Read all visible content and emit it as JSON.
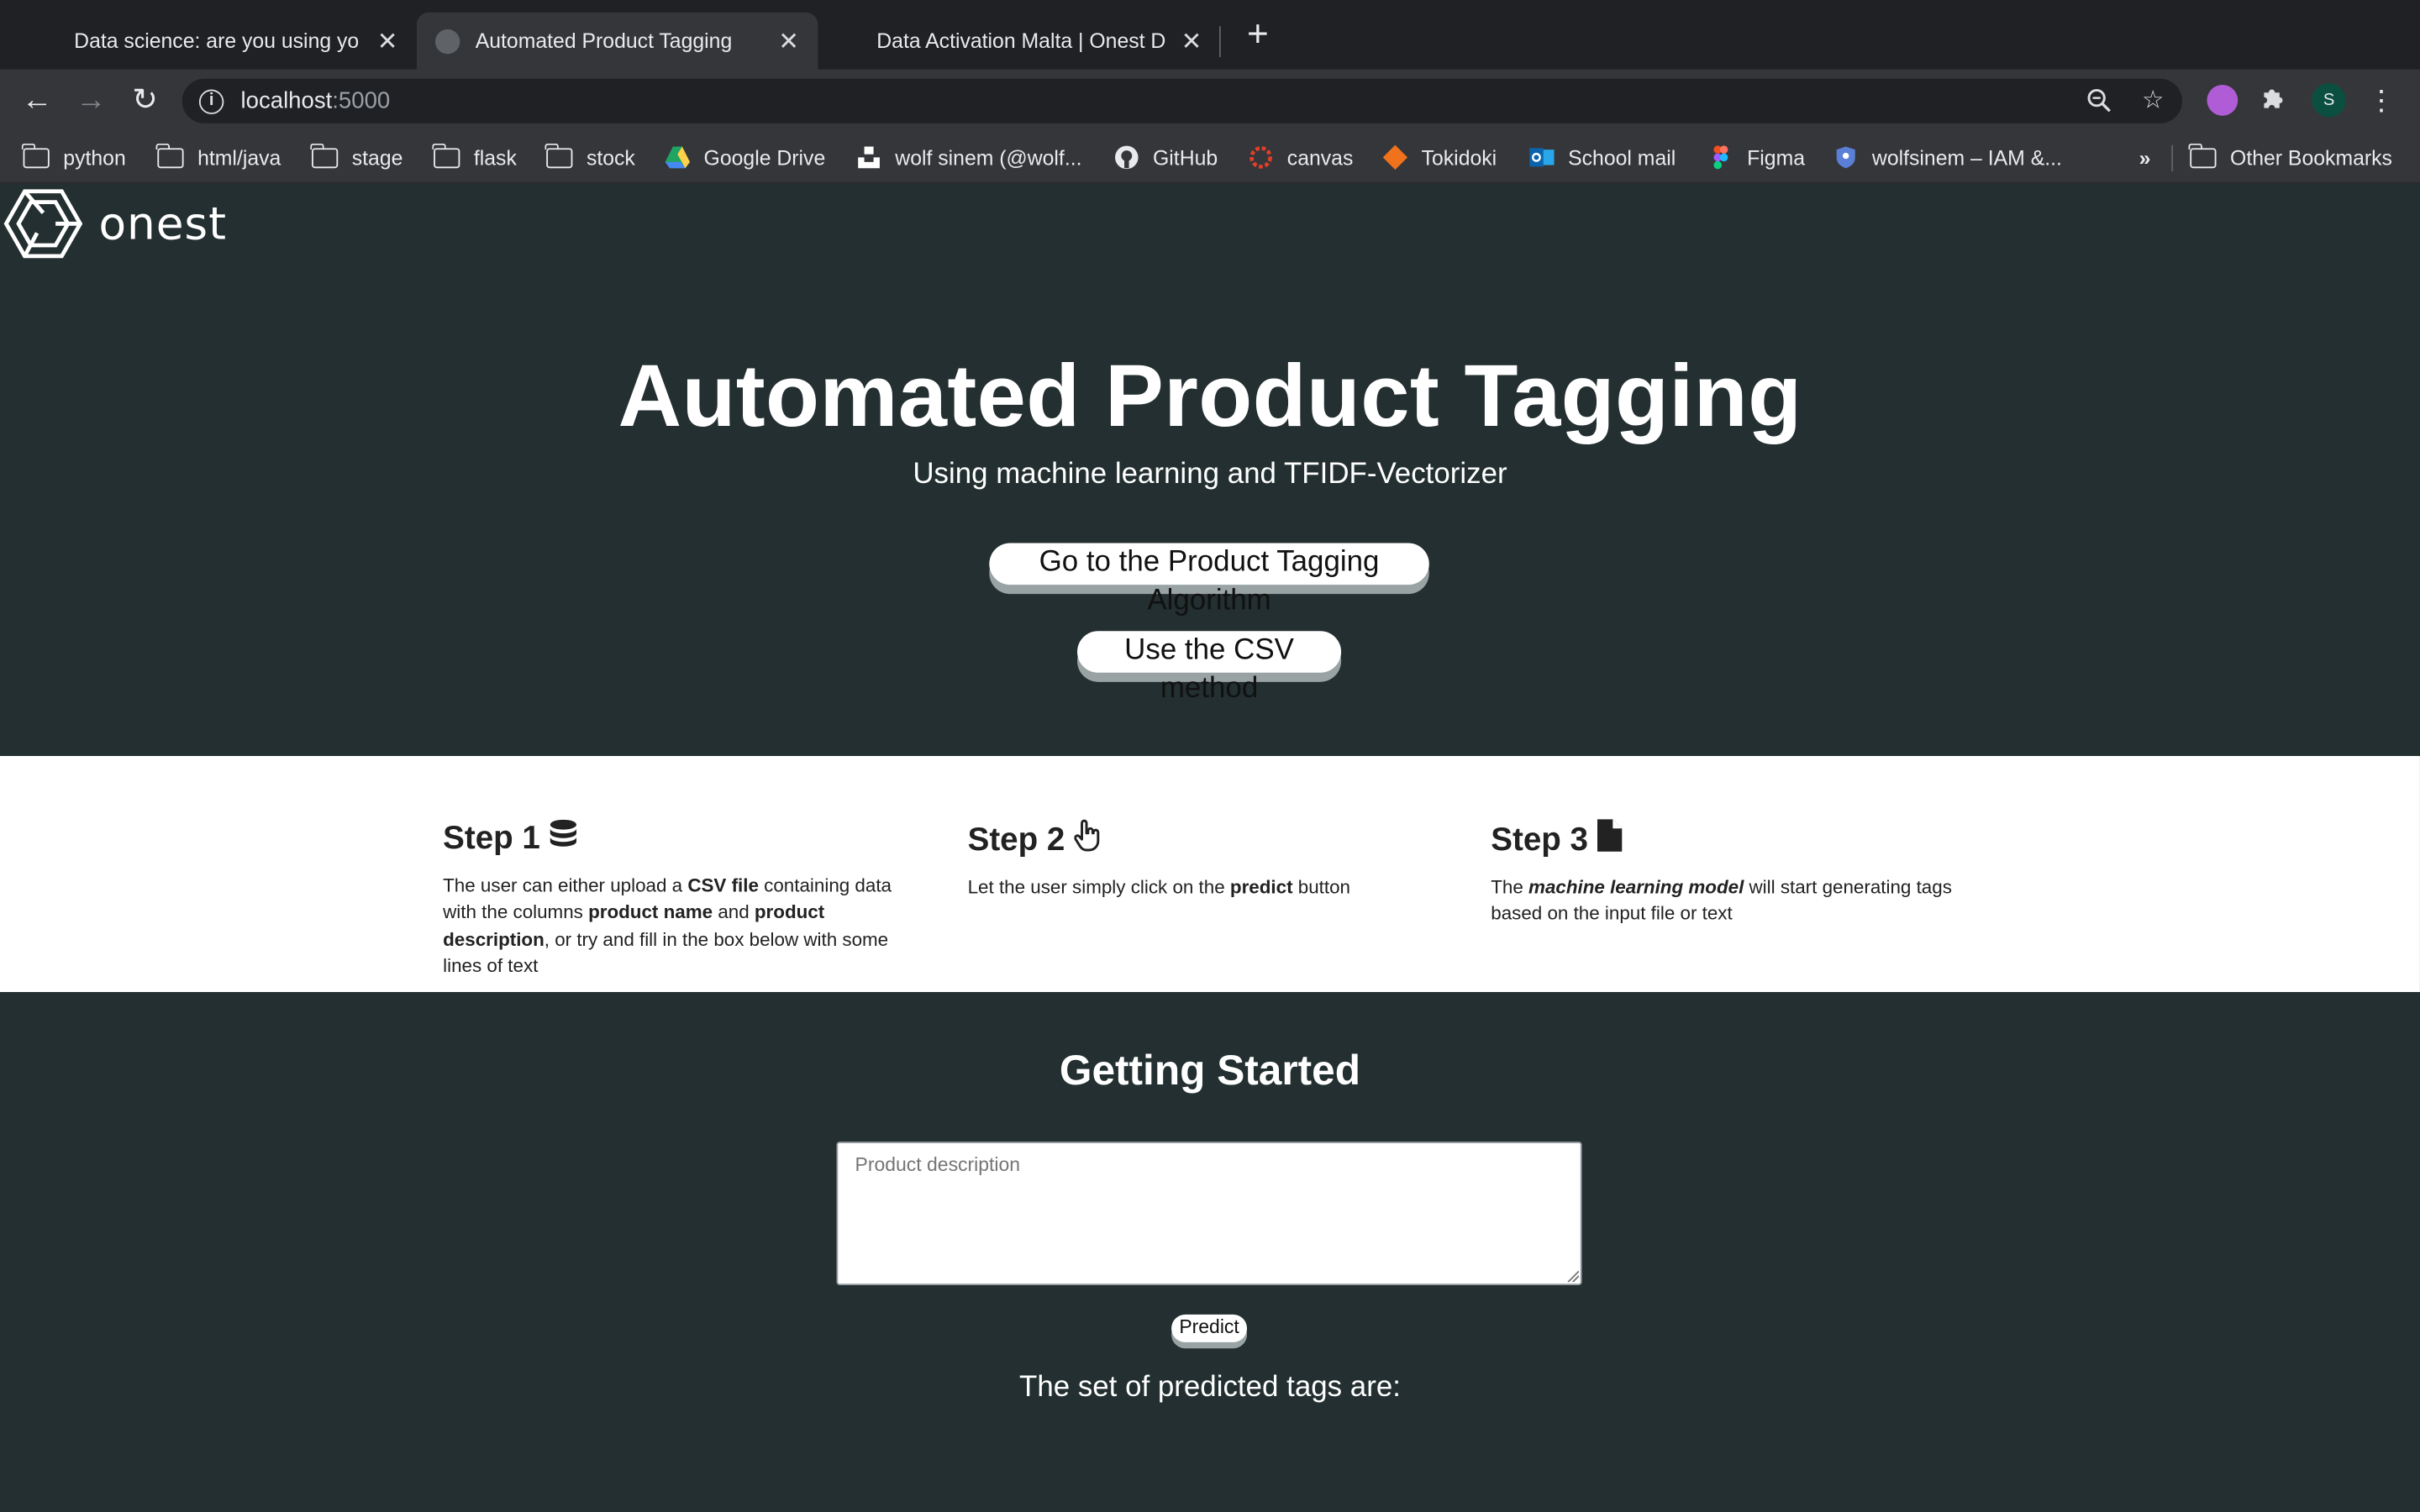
{
  "browser": {
    "tabs": [
      {
        "title": "Data science: are you using yo",
        "active": false
      },
      {
        "title": "Automated Product Tagging",
        "active": true
      },
      {
        "title": "Data Activation Malta | Onest D",
        "active": false
      }
    ],
    "new_tab_icon": "plus-icon",
    "url_host": "localhost",
    "url_port": ":5000",
    "bookmarks": [
      {
        "label": "python",
        "icon": "folder-icon"
      },
      {
        "label": "html/java",
        "icon": "folder-icon"
      },
      {
        "label": "stage",
        "icon": "folder-icon"
      },
      {
        "label": "flask",
        "icon": "folder-icon"
      },
      {
        "label": "stock",
        "icon": "folder-icon"
      },
      {
        "label": "Google Drive",
        "icon": "google-drive-icon"
      },
      {
        "label": "wolf sinem (@wolf...",
        "icon": "unsplash-icon"
      },
      {
        "label": "GitHub",
        "icon": "github-icon"
      },
      {
        "label": "canvas",
        "icon": "canvas-icon"
      },
      {
        "label": "Tokidoki",
        "icon": "tokidoki-icon"
      },
      {
        "label": "School mail",
        "icon": "outlook-icon"
      },
      {
        "label": "Figma",
        "icon": "figma-icon"
      },
      {
        "label": "wolfsinem – IAM &...",
        "icon": "shield-icon"
      }
    ],
    "overflow_label": "»",
    "other_bookmarks": "Other Bookmarks",
    "profile_initial": "S"
  },
  "brand": {
    "logo_text": "onest"
  },
  "hero": {
    "title": "Automated Product Tagging",
    "subtitle": "Using machine learning and TFIDF-Vectorizer",
    "button_algorithm": "Go to the Product Tagging Algorithm",
    "button_csv": "Use the CSV method"
  },
  "steps": [
    {
      "title": "Step 1",
      "icon": "database-icon",
      "parts": [
        {
          "t": "The user can either upload a ",
          "b": false
        },
        {
          "t": "CSV file",
          "b": true
        },
        {
          "t": " containing data with the columns ",
          "b": false
        },
        {
          "t": "product name",
          "b": true
        },
        {
          "t": " and ",
          "b": false
        },
        {
          "t": "product description",
          "b": true
        },
        {
          "t": ", or try and fill in the box below with some lines of text",
          "b": false
        }
      ]
    },
    {
      "title": "Step 2",
      "icon": "pointer-hand-icon",
      "parts": [
        {
          "t": "Let the user simply click on the ",
          "b": false
        },
        {
          "t": "predict",
          "b": true
        },
        {
          "t": " button",
          "b": false
        }
      ]
    },
    {
      "title": "Step 3",
      "icon": "file-icon",
      "parts": [
        {
          "t": "The ",
          "b": false
        },
        {
          "t": "machine learning model",
          "b": true,
          "i": true
        },
        {
          "t": " will start generating tags based on the input file or text",
          "b": false
        }
      ]
    }
  ],
  "started": {
    "title": "Getting Started",
    "placeholder": "Product description",
    "predict_label": "Predict",
    "result_text": "The set of predicted tags are:"
  },
  "colors": {
    "page_dark": "#232f30",
    "chrome_tabstrip": "#202124",
    "chrome_toolbar": "#35363a",
    "button_shadow": "#9aa3a4"
  }
}
